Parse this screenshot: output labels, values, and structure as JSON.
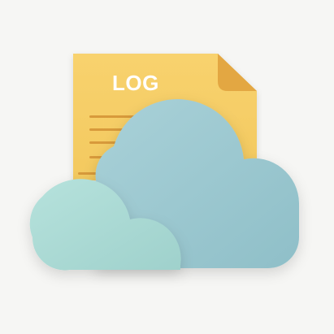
{
  "icon": {
    "document": {
      "name": "log-file-icon",
      "label": "LOG",
      "colors": {
        "paper": "#f8d26e",
        "paper_shade": "#f3c95f",
        "fold": "#e3a742",
        "lines": "#d89a3b",
        "label": "#ffffff"
      }
    },
    "cloud": {
      "name": "cloud-icon",
      "colors": {
        "back_light": "#a9d1d8",
        "back_dark": "#8fbfc8",
        "front_light": "#b6e2dc",
        "front_dark": "#9fd1cc"
      }
    },
    "background": "#f6f6f4"
  }
}
